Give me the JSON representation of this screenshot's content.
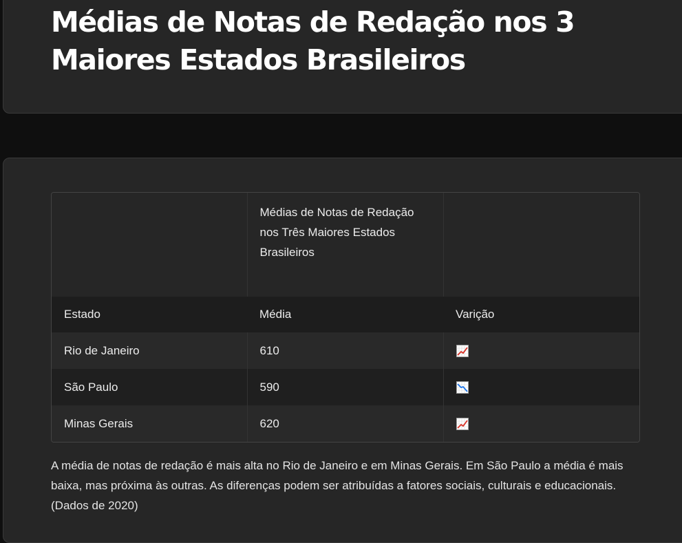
{
  "header": {
    "title": "Médias de Notas de Redação nos 3 Maiores Estados Brasileiros"
  },
  "table": {
    "caption": "Médias de Notas de Redação nos Três Maiores Estados Brasileiros",
    "columns": [
      "Estado",
      "Média",
      "Varição"
    ],
    "rows": [
      {
        "estado": "Rio de Janeiro",
        "media": "610",
        "variacao_icon": "chart-increasing-icon"
      },
      {
        "estado": "São Paulo",
        "media": "590",
        "variacao_icon": "chart-decreasing-icon"
      },
      {
        "estado": "Minas Gerais",
        "media": "620",
        "variacao_icon": "chart-increasing-icon"
      }
    ]
  },
  "summary": "A média de notas de redação é mais alta no Rio de Janeiro e em Minas Gerais. Em São Paulo a média é mais baixa, mas próxima às outras. As diferenças podem ser atribuídas a fatores sociais, culturais e educacionais. (Dados de 2020)",
  "colors": {
    "background": "#0f0f0f",
    "card": "#262626",
    "increase": "#d93025",
    "decrease": "#1a73e8"
  }
}
